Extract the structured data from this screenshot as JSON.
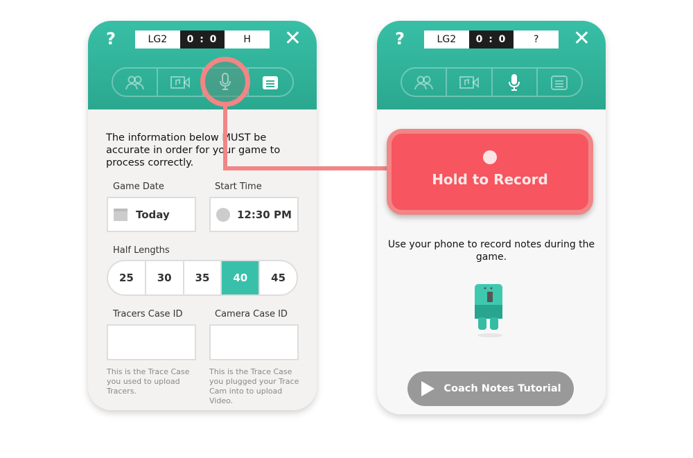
{
  "left_screen": {
    "help_label": "?",
    "close_label": "✕",
    "score": {
      "team": "LG2",
      "score": "0 : 0",
      "side": "H"
    },
    "tabs": [
      {
        "icon": "people-icon"
      },
      {
        "icon": "video-icon"
      },
      {
        "icon": "microphone-icon",
        "highlighted": true
      },
      {
        "icon": "notes-icon",
        "active": true
      }
    ],
    "intro": "The information below MUST be accurate in order for your game to process correctly.",
    "game_date": {
      "label": "Game Date",
      "value": "Today"
    },
    "start_time": {
      "label": "Start Time",
      "value": "12:30 PM"
    },
    "half_lengths": {
      "label": "Half Lengths",
      "options": [
        "25",
        "30",
        "35",
        "40",
        "45"
      ],
      "selected": "40"
    },
    "tracers": {
      "label": "Tracers Case ID",
      "value": "",
      "help": "This is the Trace Case you used to upload Tracers."
    },
    "camera": {
      "label": "Camera Case ID",
      "value": "",
      "help": "This is the Trace Case you plugged your Trace Cam into to upload Video."
    }
  },
  "right_screen": {
    "help_label": "?",
    "close_label": "✕",
    "score": {
      "team": "LG2",
      "score": "0 : 0",
      "side": "?"
    },
    "tabs": [
      {
        "icon": "people-icon"
      },
      {
        "icon": "video-icon"
      },
      {
        "icon": "microphone-icon",
        "active": true
      },
      {
        "icon": "notes-icon"
      }
    ],
    "record_label": "Hold to Record",
    "description": "Use your phone to record notes during the game.",
    "tutorial_label": "Coach Notes Tutorial"
  },
  "colors": {
    "accent": "#38c0aa",
    "record": "#f7555f",
    "highlight": "#f28585"
  }
}
